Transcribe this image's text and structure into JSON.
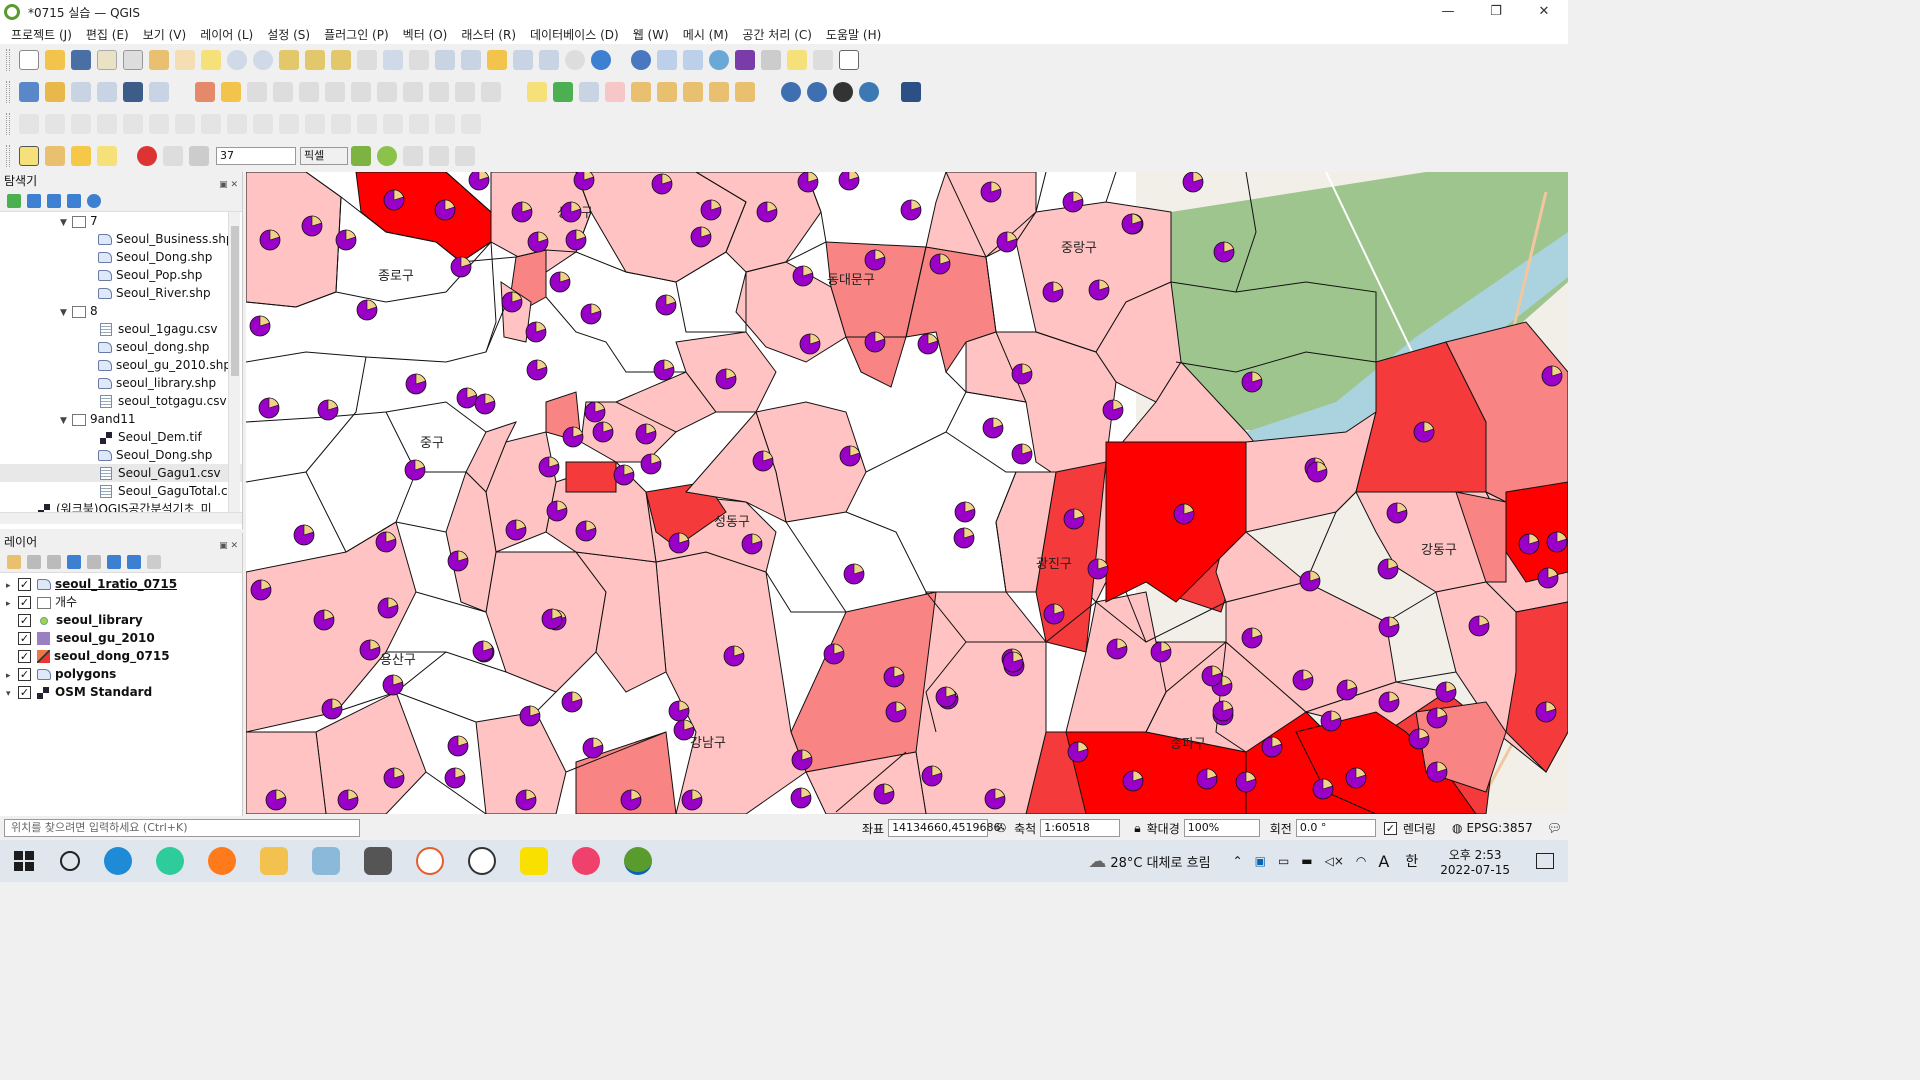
{
  "window": {
    "title": "*0715 실습 — QGIS",
    "controls": [
      "—",
      "❐",
      "✕"
    ]
  },
  "menu": [
    "프로젝트 (J)",
    "편집 (E)",
    "보기 (V)",
    "레이어 (L)",
    "설정 (S)",
    "플러그인 (P)",
    "벡터 (O)",
    "래스터 (R)",
    "데이터베이스 (D)",
    "웹 (W)",
    "메시 (M)",
    "공간 처리 (C)",
    "도움말 (H)"
  ],
  "snapping": {
    "tolerance": "37",
    "unit": "픽셀"
  },
  "browser": {
    "title": "탐색기",
    "items": [
      {
        "label": "7",
        "type": "folder"
      },
      {
        "label": "Seoul_Business.shp",
        "type": "shp"
      },
      {
        "label": "Seoul_Dong.shp",
        "type": "shp"
      },
      {
        "label": "Seoul_Pop.shp",
        "type": "shp"
      },
      {
        "label": "Seoul_River.shp",
        "type": "shp"
      },
      {
        "label": "8",
        "type": "folder"
      },
      {
        "label": "seoul_1gagu.csv",
        "type": "csv"
      },
      {
        "label": "seoul_dong.shp",
        "type": "shp"
      },
      {
        "label": "seoul_gu_2010.shp",
        "type": "shp"
      },
      {
        "label": "seoul_library.shp",
        "type": "shp"
      },
      {
        "label": "seoul_totgagu.csv",
        "type": "csv"
      },
      {
        "label": "9and11",
        "type": "folder"
      },
      {
        "label": "Seoul_Dem.tif",
        "type": "raster"
      },
      {
        "label": "Seoul_Dong.shp",
        "type": "shp"
      },
      {
        "label": "Seoul_Gagu1.csv",
        "type": "csv"
      },
      {
        "label": "Seoul_GaguTotal.cs",
        "type": "csv"
      },
      {
        "label": "(워크북)QGIS공간분석기초_미",
        "type": "raster"
      }
    ]
  },
  "layers": {
    "title": "레이어",
    "items": [
      {
        "label": "seoul_1ratio_0715",
        "bold": true,
        "underline": true,
        "expand": true
      },
      {
        "label": "개수",
        "bold": false,
        "expand": true
      },
      {
        "label": "seoul_library",
        "bold": true,
        "expand": false
      },
      {
        "label": "seoul_gu_2010",
        "bold": true,
        "expand": false
      },
      {
        "label": "seoul_dong_0715",
        "bold": true,
        "expand": false
      },
      {
        "label": "polygons",
        "bold": true,
        "expand": true
      },
      {
        "label": "OSM Standard",
        "bold": true,
        "expand": true
      }
    ]
  },
  "map": {
    "district_labels": [
      "성북구",
      "종로구",
      "동대문구",
      "중랑구",
      "중구",
      "성동구",
      "광진구",
      "용산구",
      "강남구",
      "송파구",
      "강동구"
    ]
  },
  "statusbar": {
    "locator_placeholder": "위치를 찾으려면 입력하세요 (Ctrl+K)",
    "coord_label": "좌표",
    "coord": "14134660,4519686",
    "scale_label": "축척",
    "scale": "1:60518",
    "mag_label": "확대경",
    "mag": "100%",
    "rot_label": "회전",
    "rot": "0.0 °",
    "render_label": "렌더링",
    "crs": "EPSG:3857"
  },
  "taskbar": {
    "weather": "28°C 대체로 흐림",
    "ime1": "A",
    "ime2": "한",
    "time": "오후 2:53",
    "date": "2022-07-15"
  },
  "colors": {
    "fill_light": "#ffc3c3",
    "fill_mid": "#f88484",
    "fill_strong": "#f43a3a",
    "fill_max": "#ff0000",
    "pie_main": "#9b00c8",
    "pie_slice": "#f2d28a",
    "park": "#9dc58d",
    "river": "#aad3df"
  }
}
